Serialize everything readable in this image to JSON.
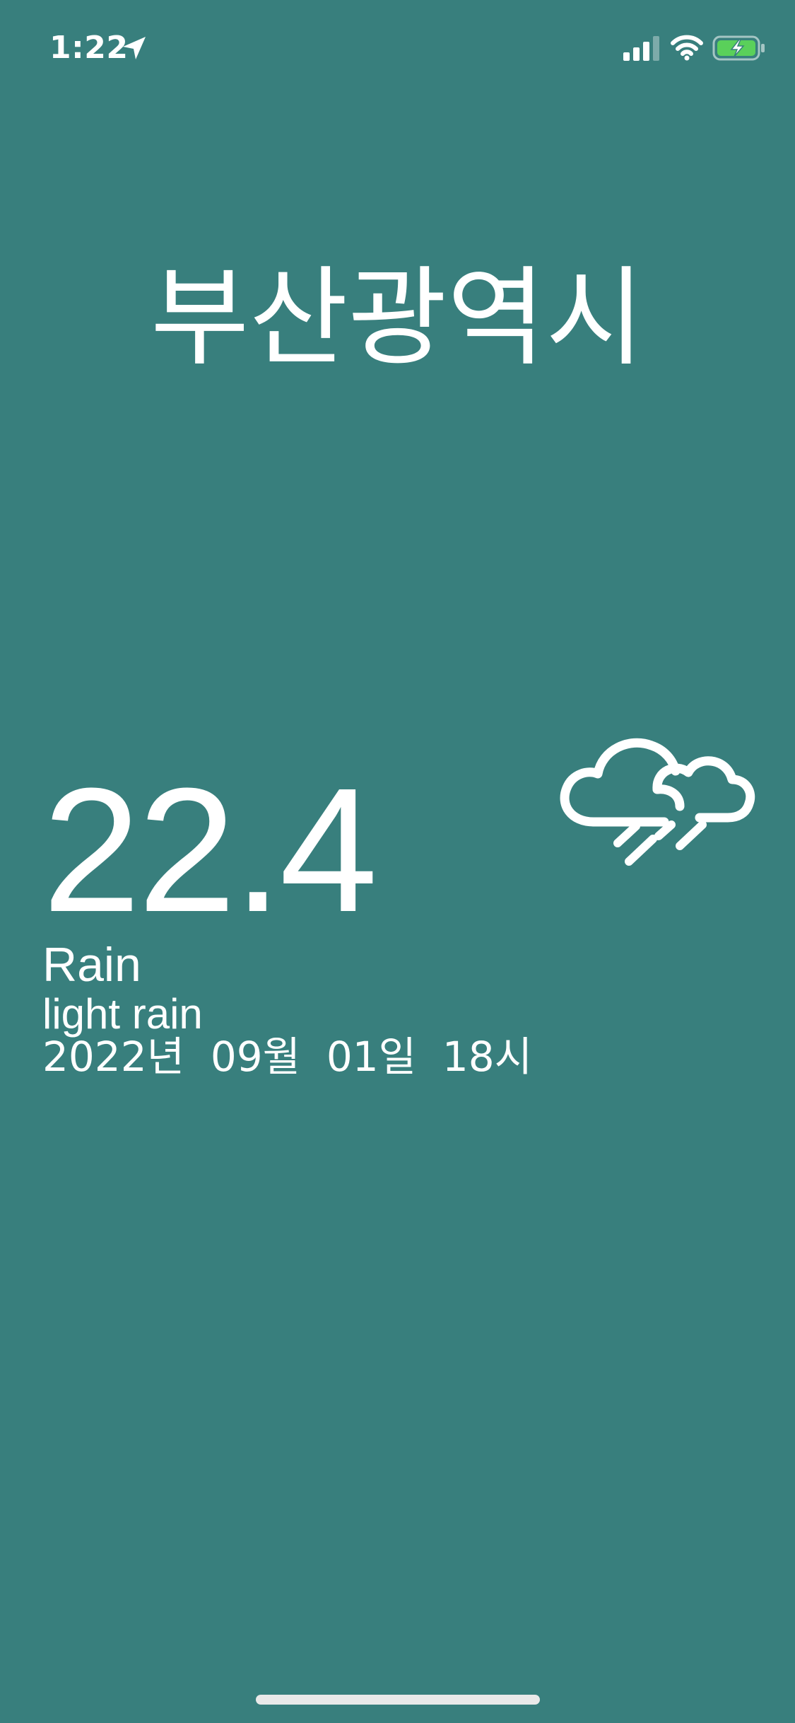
{
  "status_bar": {
    "time": "1:22",
    "icons": [
      "location-arrow-icon",
      "cellular-signal-icon",
      "wifi-icon",
      "battery-charging-icon"
    ],
    "battery_color": "#5ad05a"
  },
  "city": {
    "name": "부산광역시"
  },
  "weather": {
    "temperature": "22.4",
    "main": "Rain",
    "description": "light rain",
    "date": "2022년  09월  01일  18시",
    "icon": "cloud-rain-icon"
  },
  "colors": {
    "background": "#387f7d",
    "text": "#ffffff"
  }
}
